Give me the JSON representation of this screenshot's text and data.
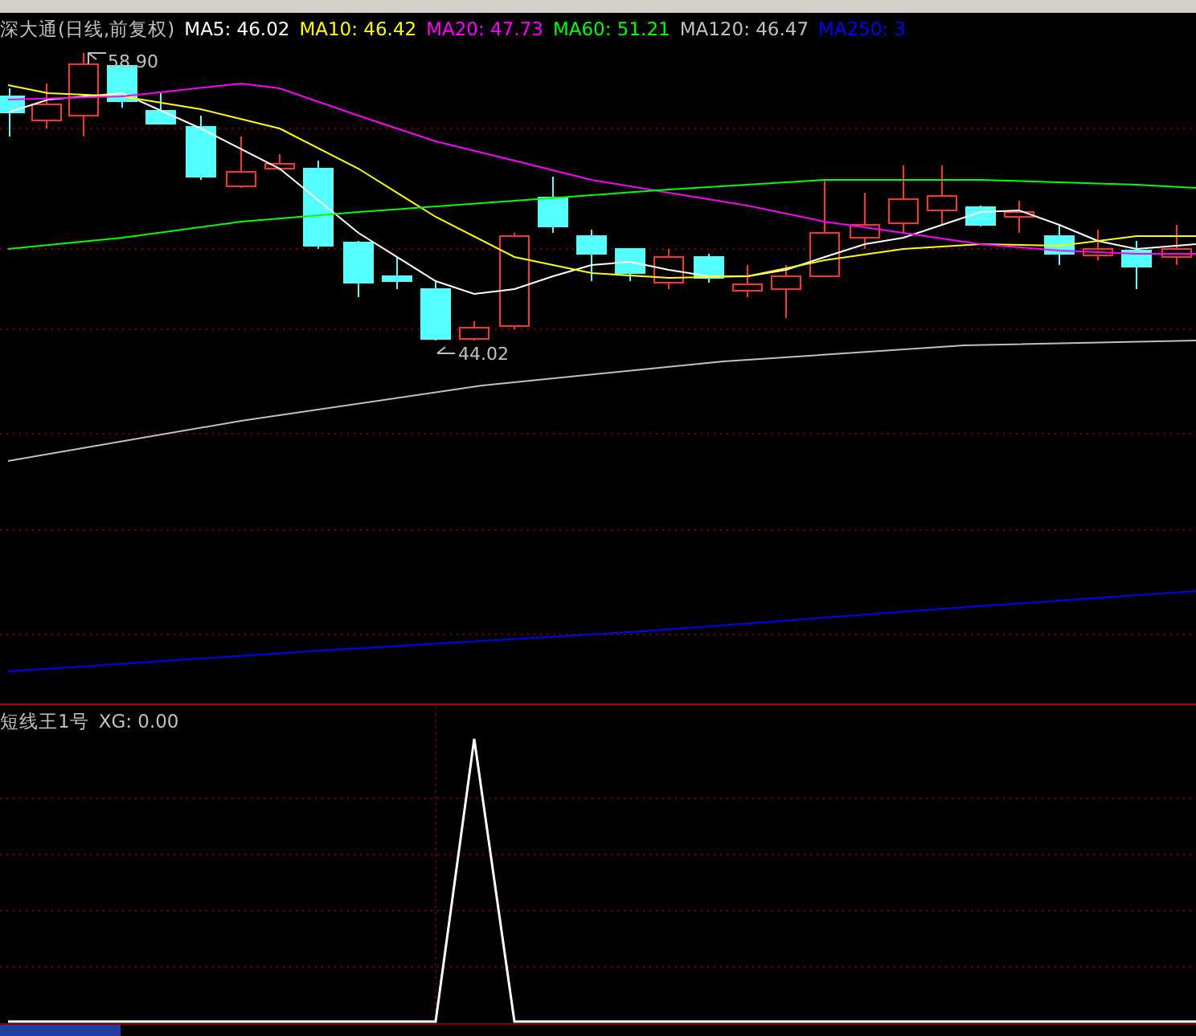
{
  "main_panel": {
    "security": "深大通(日线,前复权)",
    "indicators": [
      {
        "label": "MA5: 46.02",
        "color": "#ffffff"
      },
      {
        "label": "MA10: 46.42",
        "color": "#ffff00"
      },
      {
        "label": "MA20: 47.73",
        "color": "#ff00ff"
      },
      {
        "label": "MA60: 51.21",
        "color": "#00ff00"
      },
      {
        "label": "MA120: 46.47",
        "color": "#c0c0c0"
      },
      {
        "label": "MA250: 3",
        "color": "#0000ff"
      }
    ],
    "high_mark": "58.90",
    "low_mark": "44.02"
  },
  "lower_panel": {
    "title": "短线王1号",
    "reading": "XG: 0.00"
  }
}
